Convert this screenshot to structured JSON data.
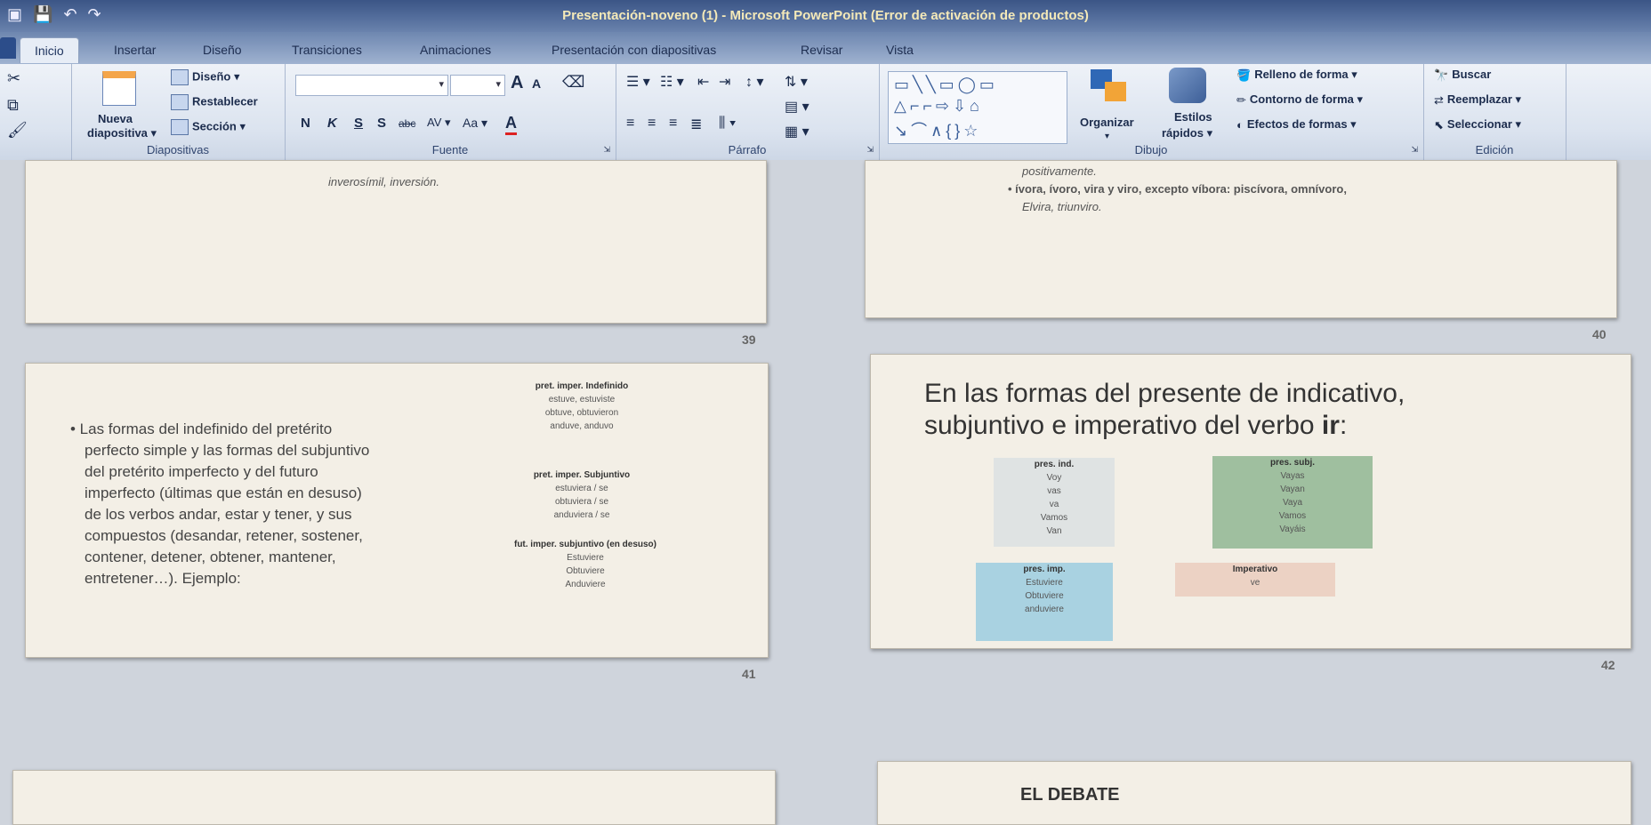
{
  "window": {
    "title": "Presentación-noveno (1) - Microsoft PowerPoint (Error de activación de productos)"
  },
  "tabs": [
    "Inicio",
    "Insertar",
    "Diseño",
    "Transiciones",
    "Animaciones",
    "Presentación con diapositivas",
    "Revisar",
    "Vista"
  ],
  "ribbon": {
    "diapositivas": {
      "nueva": "Nueva",
      "diapositiva": "diapositiva",
      "diseno": "Diseño",
      "restablecer": "Restablecer",
      "seccion": "Sección",
      "group_label": "Diapositivas"
    },
    "fuente": {
      "bold": "N",
      "italic": "K",
      "underline": "S",
      "strike": "S",
      "grow": "A",
      "shrink": "A",
      "case": "Aa",
      "color": "A",
      "group_label": "Fuente"
    },
    "parrafo": {
      "group_label": "Párrafo"
    },
    "dibujo": {
      "organizar": "Organizar",
      "estilos": "Estilos",
      "rapidos": "rápidos",
      "relleno": "Relleno de forma",
      "contorno": "Contorno de forma",
      "efectos": "Efectos de formas",
      "group_label": "Dibujo"
    },
    "edicion": {
      "buscar": "Buscar",
      "reemplazar": "Reemplazar",
      "seleccionar": "Seleccionar",
      "group_label": "Edición"
    }
  },
  "slides": {
    "s39": {
      "number": "39",
      "text": "inverosímil, inversión."
    },
    "s40": {
      "number": "40",
      "line1": "positivamente.",
      "line2": "• ívora, ívoro, vira y viro, excepto víbora: piscívora, omnívoro,",
      "line3": "Elvira, triunviro."
    },
    "s41": {
      "number": "41",
      "bullet_lines": [
        "• Las formas del indefinido del pretérito",
        "perfecto simple y las formas del subjuntivo",
        "del pretérito imperfecto y del futuro",
        "imperfecto (últimas que están en desuso)",
        "de los verbos andar, estar y tener, y sus",
        "compuestos (desandar, retener, sostener,",
        "contener, detener, obtener, mantener,",
        "entretener…). Ejemplo:"
      ],
      "block1": {
        "heading": "pret. imper. Indefinido",
        "lines": [
          "estuve, estuviste",
          "obtuve, obtuvieron",
          "anduve, anduvo"
        ]
      },
      "block2": {
        "heading": "pret. imper. Subjuntivo",
        "lines": [
          "estuviera / se",
          "obtuviera / se",
          "anduviera / se"
        ]
      },
      "block3": {
        "heading": "fut. imper. subjuntivo (en desuso)",
        "lines": [
          "Estuviere",
          "Obtuviere",
          "Anduviere"
        ]
      }
    },
    "s42": {
      "number": "42",
      "title_line1": "En las formas del presente de indicativo,",
      "title_line2_start": "subjuntivo e imperativo  del verbo ",
      "title_line2_bold": "ir",
      "title_line2_end": ":",
      "box_ind": {
        "heading": "pres. ind.",
        "lines": [
          "Voy",
          "vas",
          "va",
          "Vamos",
          "Van"
        ],
        "color": "#dfe3e3"
      },
      "box_subj": {
        "heading": "pres. subj.",
        "lines": [
          "Vayas",
          "Vayan",
          "Vaya",
          "Vamos",
          "Vayáis"
        ],
        "color": "#9fbf9f"
      },
      "box_imp": {
        "heading": "pres. imp.",
        "lines": [
          "Estuviere",
          "Obtuviere",
          "anduviere"
        ],
        "color": "#a9d2e1"
      },
      "box_imperativo": {
        "heading": "Imperativo",
        "lines": [
          "ve"
        ],
        "color": "#ecd2c4"
      }
    },
    "s44": {
      "title": "EL DEBATE"
    }
  }
}
